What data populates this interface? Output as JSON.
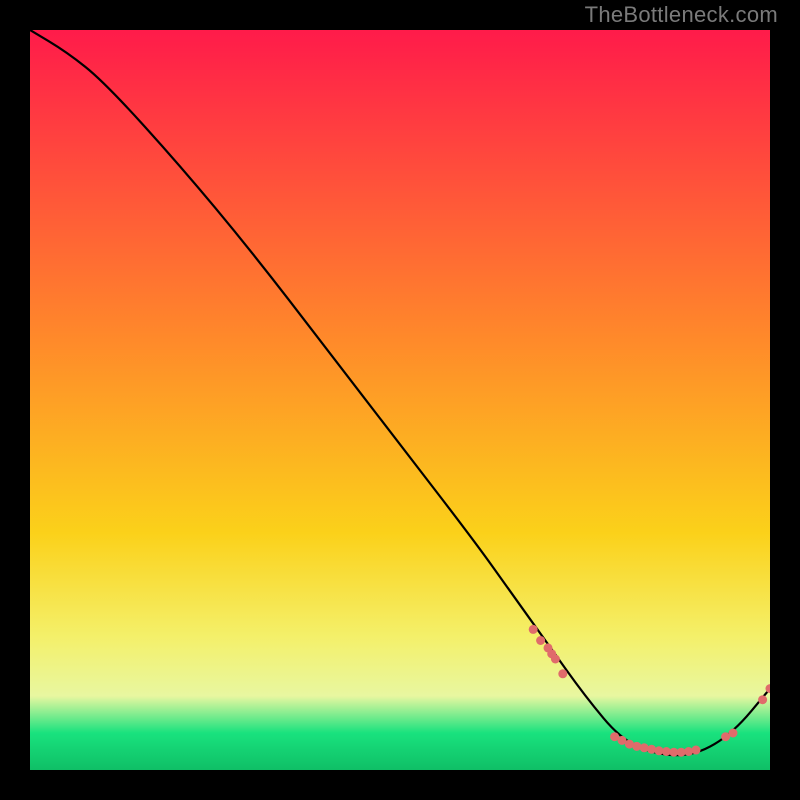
{
  "watermark": "TheBottleneck.com",
  "chart_data": {
    "type": "line",
    "title": "",
    "xlabel": "",
    "ylabel": "",
    "xlim": [
      0,
      100
    ],
    "ylim": [
      0,
      100
    ],
    "series": [
      {
        "name": "curve",
        "x": [
          0,
          5,
          10,
          20,
          30,
          40,
          50,
          60,
          65,
          70,
          75,
          80,
          85,
          90,
          95,
          100
        ],
        "y": [
          100,
          97,
          93,
          82,
          70,
          57,
          44,
          31,
          24,
          17,
          10,
          4,
          2,
          2,
          5,
          11
        ]
      }
    ],
    "markers": {
      "name": "highlighted-points",
      "points": [
        {
          "x": 68,
          "y": 19
        },
        {
          "x": 69,
          "y": 17.5
        },
        {
          "x": 70,
          "y": 16.5
        },
        {
          "x": 70.5,
          "y": 15.7
        },
        {
          "x": 71,
          "y": 15
        },
        {
          "x": 72,
          "y": 13
        },
        {
          "x": 79,
          "y": 4.5
        },
        {
          "x": 80,
          "y": 4
        },
        {
          "x": 81,
          "y": 3.5
        },
        {
          "x": 82,
          "y": 3.2
        },
        {
          "x": 83,
          "y": 3
        },
        {
          "x": 84,
          "y": 2.8
        },
        {
          "x": 85,
          "y": 2.6
        },
        {
          "x": 86,
          "y": 2.5
        },
        {
          "x": 87,
          "y": 2.4
        },
        {
          "x": 88,
          "y": 2.4
        },
        {
          "x": 89,
          "y": 2.5
        },
        {
          "x": 90,
          "y": 2.7
        },
        {
          "x": 94,
          "y": 4.5
        },
        {
          "x": 95,
          "y": 5
        },
        {
          "x": 99,
          "y": 9.5
        },
        {
          "x": 100,
          "y": 11
        }
      ]
    },
    "background_gradient": {
      "top": "#ff1b4a",
      "mid": "#fbd11a",
      "green": "#19e27e",
      "bottom": "#0fbf66"
    },
    "curve_label": {
      "text": "",
      "x": 85,
      "y": 3.8
    }
  }
}
